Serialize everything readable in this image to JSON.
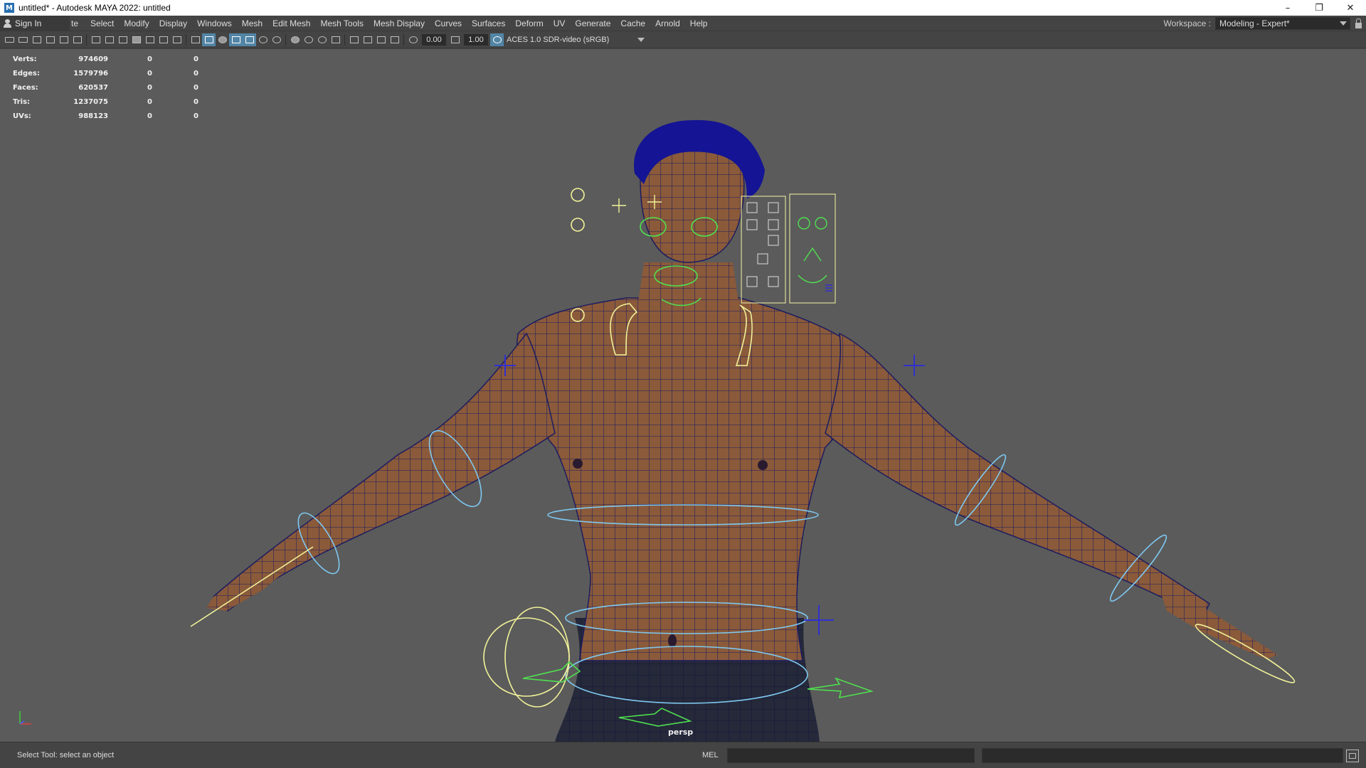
{
  "window": {
    "title": "untitled* - Autodesk MAYA 2022: untitled",
    "app_icon": "M",
    "controls": {
      "minimize": "–",
      "restore": "❐",
      "close": "✕"
    }
  },
  "menubar": {
    "signin_label": "Sign In",
    "items": [
      "te",
      "Select",
      "Modify",
      "Display",
      "Windows",
      "Mesh",
      "Edit Mesh",
      "Mesh Tools",
      "Mesh Display",
      "Curves",
      "Surfaces",
      "Deform",
      "UV",
      "Generate",
      "Cache",
      "Arnold",
      "Help"
    ],
    "workspace_label": "Workspace :",
    "workspace_value": "Modeling - Expert*"
  },
  "toolbar": {
    "exposure_value": "0.00",
    "gamma_value": "1.00",
    "color_space": "ACES 1.0 SDR-video (sRGB)",
    "icons": [
      "camera-icon",
      "camera-attr-icon",
      "bookmark-icon",
      "image-plane-icon",
      "grid-icon",
      "film-gate-icon",
      "resolution-gate-icon",
      "gate-mask-icon",
      "wireframe-icon",
      "smooth-shade-icon",
      "wireframe-on-shaded-icon",
      "textured-icon",
      "lights-icon",
      "shadows-icon",
      "isolate-icon",
      "xray-icon",
      "color-management-icon"
    ]
  },
  "hud": {
    "rows": [
      {
        "label": "Verts:",
        "value": "974609",
        "a": "0",
        "b": "0"
      },
      {
        "label": "Edges:",
        "value": "1579796",
        "a": "0",
        "b": "0"
      },
      {
        "label": "Faces:",
        "value": "620537",
        "a": "0",
        "b": "0"
      },
      {
        "label": "Tris:",
        "value": "1237075",
        "a": "0",
        "b": "0"
      },
      {
        "label": "UVs:",
        "value": "988123",
        "a": "0",
        "b": "0"
      }
    ],
    "camera_name": "persp"
  },
  "colors": {
    "viewport_bg": "#5b5b5b",
    "skin": "#8a5a3a",
    "wire": "#1c1c60",
    "ctrl_cyan": "#7ec8f0",
    "ctrl_yellow": "#f2f29a",
    "ctrl_green": "#4fe04f",
    "ctrl_blue": "#3030d0"
  },
  "statusbar": {
    "help_line": "Select Tool: select an object",
    "mel_label": "MEL"
  }
}
